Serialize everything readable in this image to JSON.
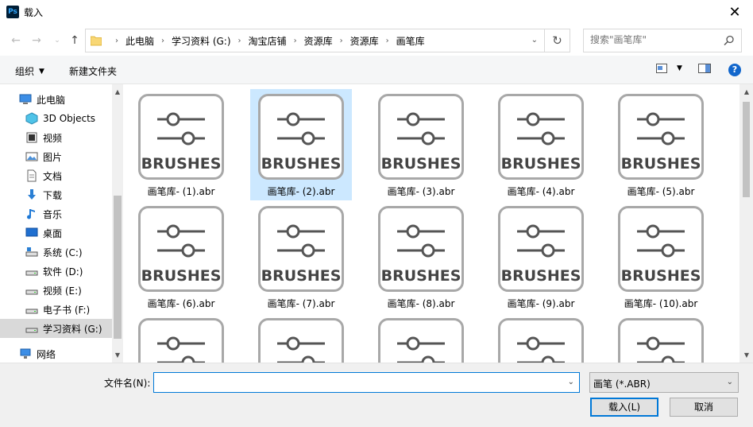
{
  "window": {
    "title": "载入",
    "app_icon": "Ps"
  },
  "address": {
    "breadcrumbs": [
      "此电脑",
      "学习资料 (G:)",
      "淘宝店铺",
      "资源库",
      "资源库",
      "画笔库"
    ]
  },
  "search": {
    "placeholder": "搜索\"画笔库\""
  },
  "toolbar": {
    "organize": "组织",
    "new_folder": "新建文件夹"
  },
  "sidebar": {
    "items": [
      {
        "label": "此电脑",
        "icon": "pc-icon"
      },
      {
        "label": "3D Objects",
        "icon": "3d-objects-icon"
      },
      {
        "label": "视频",
        "icon": "video-icon"
      },
      {
        "label": "图片",
        "icon": "pictures-icon"
      },
      {
        "label": "文档",
        "icon": "documents-icon"
      },
      {
        "label": "下载",
        "icon": "download-icon"
      },
      {
        "label": "音乐",
        "icon": "music-icon"
      },
      {
        "label": "桌面",
        "icon": "desktop-icon"
      },
      {
        "label": "系统 (C:)",
        "icon": "drive-system-icon"
      },
      {
        "label": "软件 (D:)",
        "icon": "drive-icon"
      },
      {
        "label": "视频 (E:)",
        "icon": "drive-icon"
      },
      {
        "label": "电子书 (F:)",
        "icon": "drive-icon"
      },
      {
        "label": "学习资料 (G:)",
        "icon": "drive-icon",
        "selected": true
      },
      {
        "label": "网络",
        "icon": "network-icon"
      }
    ]
  },
  "files": {
    "thumb_text": "BRUSHES",
    "items": [
      {
        "name": "画笔库- (1).abr"
      },
      {
        "name": "画笔库- (2).abr",
        "selected": true
      },
      {
        "name": "画笔库- (3).abr"
      },
      {
        "name": "画笔库- (4).abr"
      },
      {
        "name": "画笔库- (5).abr"
      },
      {
        "name": "画笔库- (6).abr"
      },
      {
        "name": "画笔库- (7).abr"
      },
      {
        "name": "画笔库- (8).abr"
      },
      {
        "name": "画笔库- (9).abr"
      },
      {
        "name": "画笔库- (10).abr"
      },
      {
        "name": ""
      },
      {
        "name": ""
      },
      {
        "name": ""
      },
      {
        "name": ""
      },
      {
        "name": ""
      }
    ]
  },
  "footer": {
    "filename_label": "文件名(N):",
    "filename_value": "",
    "filetype": "画笔 (*.ABR)",
    "load_button": "载入(L)",
    "cancel_button": "取消"
  }
}
